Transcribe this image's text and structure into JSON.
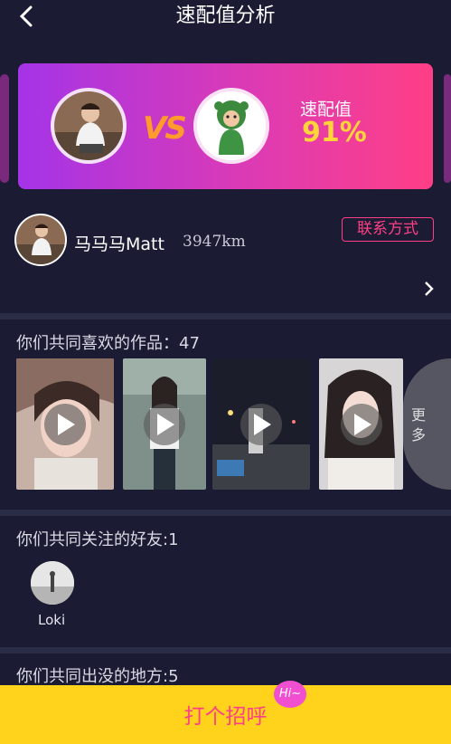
{
  "header": {
    "back_icon": "back-chevron-icon",
    "title": "速配值分析"
  },
  "match_card": {
    "vs_text": "VS",
    "match_label": "速配值",
    "match_value": "91%",
    "gradient_colors": [
      "#a434e8",
      "#ff3f86"
    ]
  },
  "user": {
    "name": "马马马Matt",
    "distance": "3947km",
    "contact_label": "联系方式"
  },
  "works": {
    "title": "你们共同喜欢的作品：47",
    "more_label": "更多",
    "thumbnails": [
      {
        "name": "work-thumb-1"
      },
      {
        "name": "work-thumb-2"
      },
      {
        "name": "work-thumb-3"
      },
      {
        "name": "work-thumb-4"
      }
    ]
  },
  "friends": {
    "title": "你们共同关注的好友:1",
    "items": [
      {
        "name": "Loki"
      }
    ]
  },
  "places": {
    "title": "你们共同出没的地方:5"
  },
  "footer": {
    "greet_label": "打个招呼",
    "badge": "Hi~"
  }
}
